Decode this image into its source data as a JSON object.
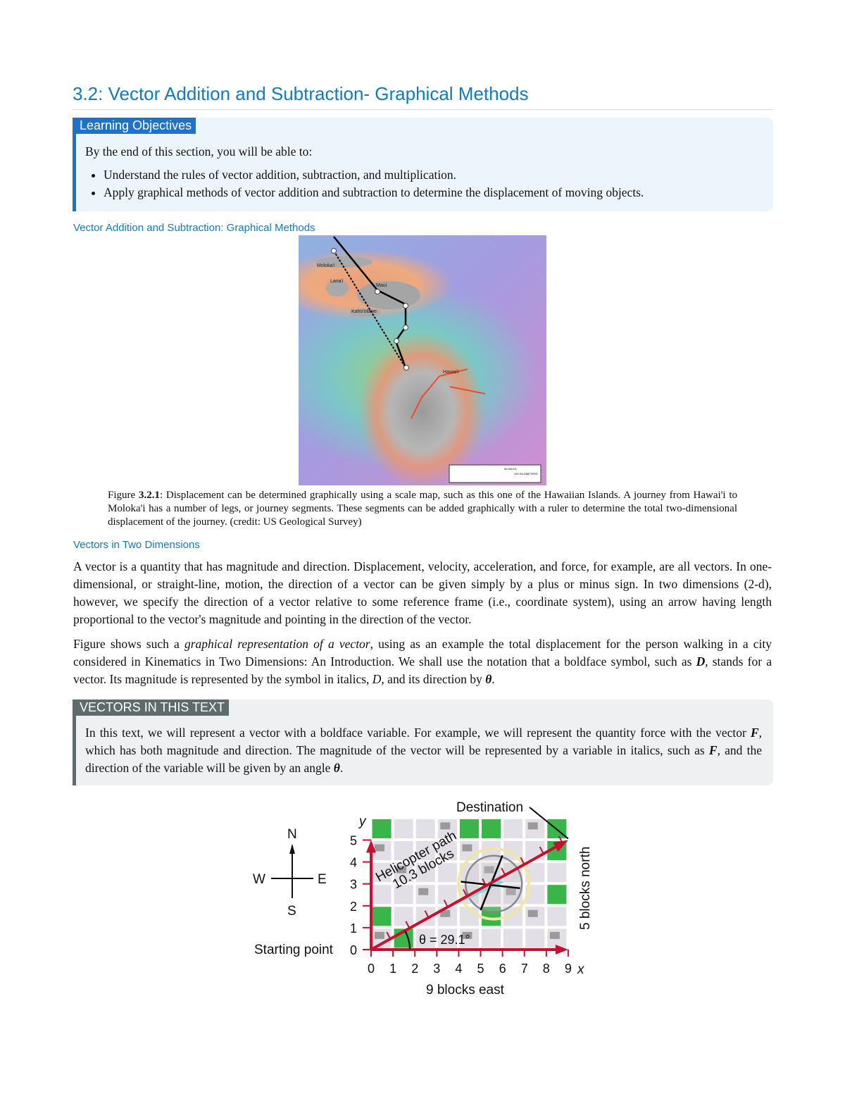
{
  "page": {
    "title": "3.2: Vector Addition and Subtraction- Graphical Methods",
    "learning_objectives": {
      "label": "Learning Objectives",
      "intro": "By the end of this section, you will be able to:",
      "items": [
        "Understand the rules of vector addition, subtraction, and multiplication.",
        "Apply graphical methods of vector addition and subtraction to determine the displacement of moving objects."
      ]
    },
    "section1_heading": "Vector Addition and Subtraction: Graphical Methods",
    "figure1": {
      "map_labels": [
        "Moloka'i",
        "Lana'i",
        "Maui",
        "Kaho'olawe",
        "Hawai'i",
        "50 MILES",
        "100 KILOMETERS"
      ],
      "caption_prefix": "Figure ",
      "caption_number": "3.2.1",
      "caption_text": ": Displacement can be determined graphically using a scale map, such as this one of the Hawaiian Islands. A journey from Hawai'i to Moloka'i has a number of legs, or journey segments. These segments can be added graphically with a ruler to determine the total two-dimensional displacement of the journey. (credit: US Geological Survey)"
    },
    "section2_heading": "Vectors in Two Dimensions",
    "paragraph1": "A vector is a quantity that has magnitude and direction. Displacement, velocity, acceleration, and force, for example, are all vectors. In one-dimensional, or straight-line, motion, the direction of a vector can be given simply by a plus or minus sign. In two dimensions (2-d), however, we specify the direction of a vector relative to some reference frame (i.e., coordinate system), using an arrow having length proportional to the vector's magnitude and pointing in the direction of the vector.",
    "paragraph2": {
      "a": "Figure shows such a ",
      "em": "graphical representation of a vector",
      "b": ", using as an example the total displacement for the person walking in a city considered in Kinematics in Two Dimensions: An Introduction. We shall use the notation that a boldface symbol, such as ",
      "sym1": "D",
      "c": ", stands for a vector. Its magnitude is represented by the symbol in italics, ",
      "sym2": "D",
      "d": ", and its direction by ",
      "sym3": "θ",
      "e": "."
    },
    "vectors_box": {
      "label": "VECTORS IN THIS TEXT",
      "a": "In this text, we will represent a vector with a boldface variable. For example, we will represent the quantity force with the vector ",
      "sym1": "F",
      "b": ", which has both magnitude and direction. The magnitude of the vector will be represented by a variable in italics, such as ",
      "sym2": "F",
      "c": ", and the direction of the variable will be given by an angle ",
      "sym3": "θ",
      "d": "."
    },
    "figure2": {
      "compass": {
        "n": "N",
        "s": "S",
        "e": "E",
        "w": "W"
      },
      "start_label": "Starting point",
      "destination_label": "Destination",
      "path_label_1": "Helicopter path",
      "path_label_2": "10.3 blocks",
      "angle_label": "θ = 29.1°",
      "x_axis_label": "x",
      "y_axis_label": "y",
      "x_ticks": [
        "0",
        "1",
        "2",
        "3",
        "4",
        "5",
        "6",
        "7",
        "8",
        "9"
      ],
      "y_ticks": [
        "0",
        "1",
        "2",
        "3",
        "4",
        "5"
      ],
      "east_label": "9 blocks east",
      "north_label": "5 blocks north",
      "vector": {
        "east_blocks": 9,
        "north_blocks": 5,
        "magnitude_blocks": 10.3,
        "angle_deg": 29.1
      },
      "colors": {
        "axis": "#c8102e",
        "park": "#39b54a",
        "block": "#e2e0e6",
        "building": "#9a9a9a"
      }
    },
    "colors": {
      "heading": "#127bbd",
      "objectives_accent": "#1e73c8",
      "note_accent": "#5e6b6b"
    }
  }
}
